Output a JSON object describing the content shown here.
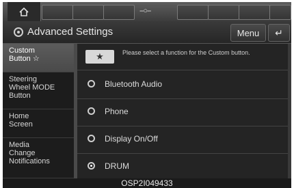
{
  "status_bar": {
    "home_icon": "home-icon",
    "center_icon": "--○--"
  },
  "header": {
    "title": "Advanced Settings",
    "settings_icon": "gear-icon",
    "menu_label": "Menu",
    "back_label": "↵"
  },
  "sidebar": {
    "items": [
      {
        "label": "Custom\nButton ☆",
        "active": true
      },
      {
        "label": "Steering\nWheel MODE\nButton",
        "active": false
      },
      {
        "label": "Home\nScreen",
        "active": false
      },
      {
        "label": "Media\nChange\nNotifications",
        "active": false
      }
    ]
  },
  "main": {
    "star_button": "★",
    "notice": "Please select a function for the Custom button.",
    "options": [
      {
        "label": "Bluetooth Audio",
        "selected": false
      },
      {
        "label": "Phone",
        "selected": false
      },
      {
        "label": "Display On/Off",
        "selected": false
      },
      {
        "label": "DRUM",
        "selected": true
      }
    ]
  },
  "caption": "OSP2I049433"
}
